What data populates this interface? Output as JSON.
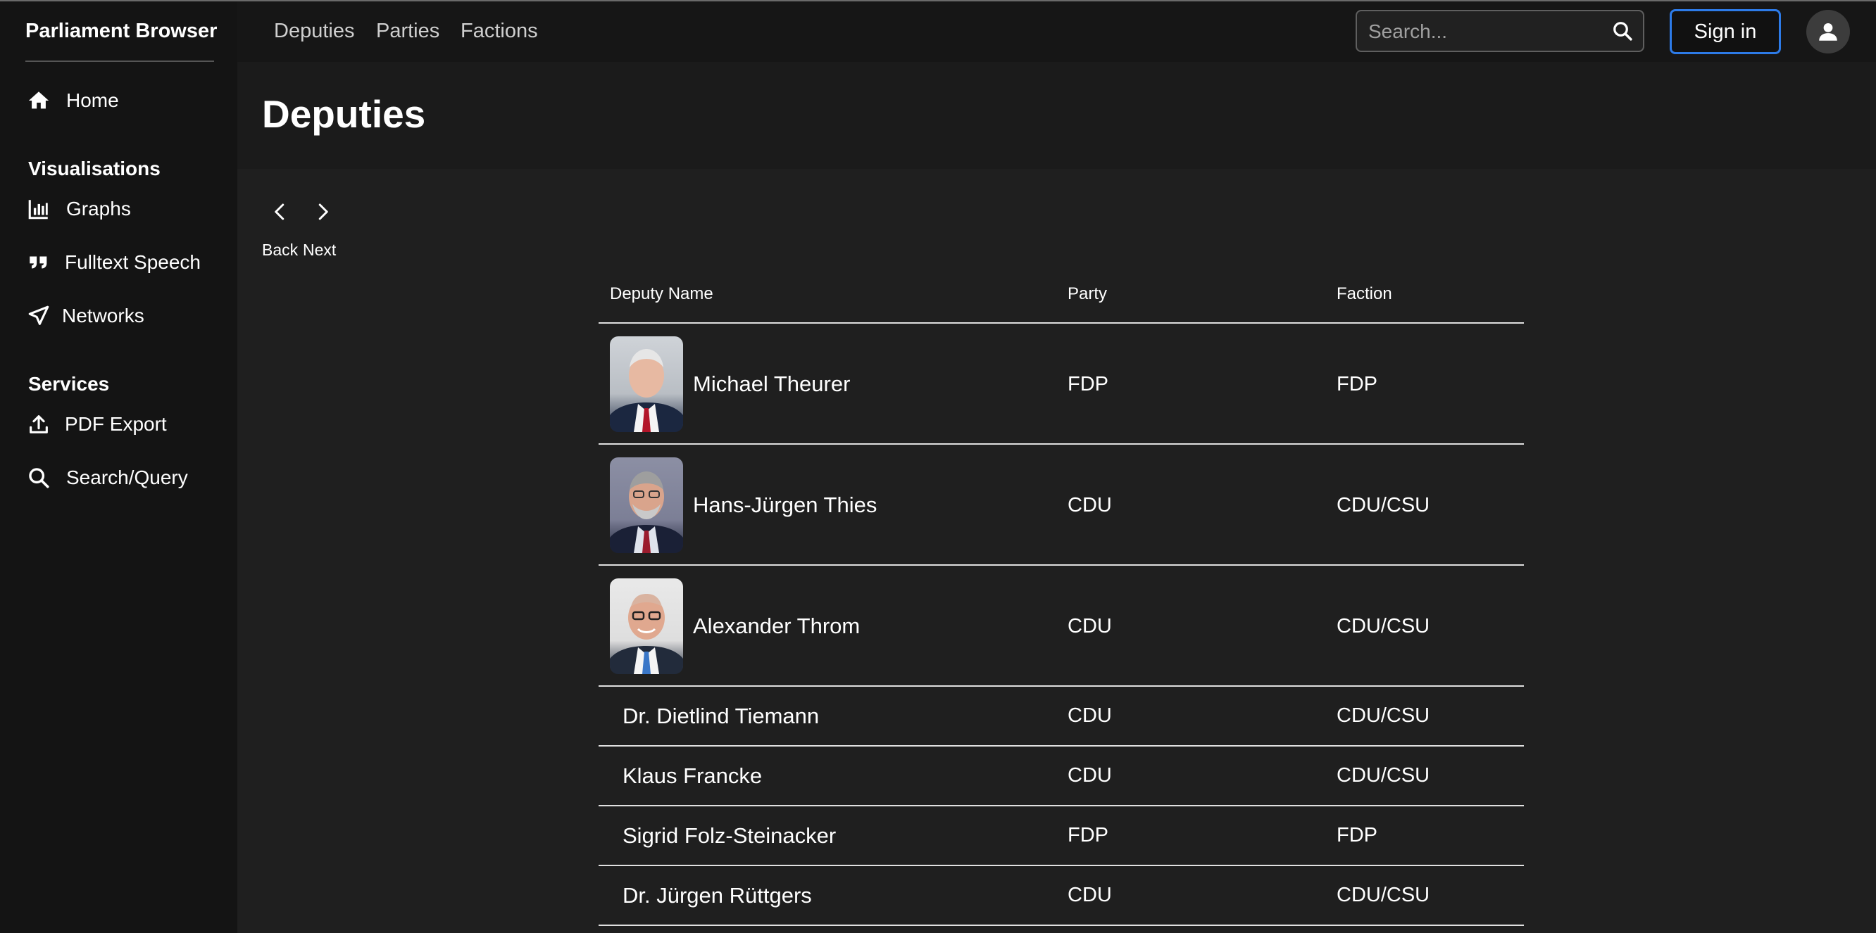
{
  "app": {
    "title": "Parliament Browser"
  },
  "sidebar": {
    "home": {
      "label": "Home",
      "icon": "home-icon"
    },
    "sections": [
      {
        "title": "Visualisations",
        "items": [
          {
            "label": "Graphs",
            "icon": "bar-chart-icon"
          },
          {
            "label": "Fulltext Speech",
            "icon": "quote-icon"
          },
          {
            "label": "Networks",
            "icon": "send-icon"
          }
        ]
      },
      {
        "title": "Services",
        "items": [
          {
            "label": "PDF Export",
            "icon": "upload-icon"
          },
          {
            "label": "Search/Query",
            "icon": "search-icon"
          }
        ]
      }
    ]
  },
  "topnav": {
    "links": [
      "Deputies",
      "Parties",
      "Factions"
    ]
  },
  "search": {
    "placeholder": "Search..."
  },
  "auth": {
    "signin_label": "Sign in"
  },
  "page": {
    "title": "Deputies"
  },
  "pager": {
    "back_label": "Back",
    "next_label": "Next"
  },
  "table": {
    "columns": [
      "Deputy Name",
      "Party",
      "Faction"
    ],
    "rows": [
      {
        "name": "Michael Theurer",
        "party": "FDP",
        "faction": "FDP",
        "has_photo": true
      },
      {
        "name": "Hans-Jürgen Thies",
        "party": "CDU",
        "faction": "CDU/CSU",
        "has_photo": true
      },
      {
        "name": "Alexander Throm",
        "party": "CDU",
        "faction": "CDU/CSU",
        "has_photo": true
      },
      {
        "name": "Dr. Dietlind Tiemann",
        "party": "CDU",
        "faction": "CDU/CSU",
        "has_photo": false
      },
      {
        "name": "Klaus Francke",
        "party": "CDU",
        "faction": "CDU/CSU",
        "has_photo": false
      },
      {
        "name": "Sigrid Folz-Steinacker",
        "party": "FDP",
        "faction": "FDP",
        "has_photo": false
      },
      {
        "name": "Dr. Jürgen Rüttgers",
        "party": "CDU",
        "faction": "CDU/CSU",
        "has_photo": false
      }
    ]
  },
  "colors": {
    "accent": "#2d7be8",
    "sidebar_bg": "#141414",
    "page_bg": "#1f1f1f"
  }
}
